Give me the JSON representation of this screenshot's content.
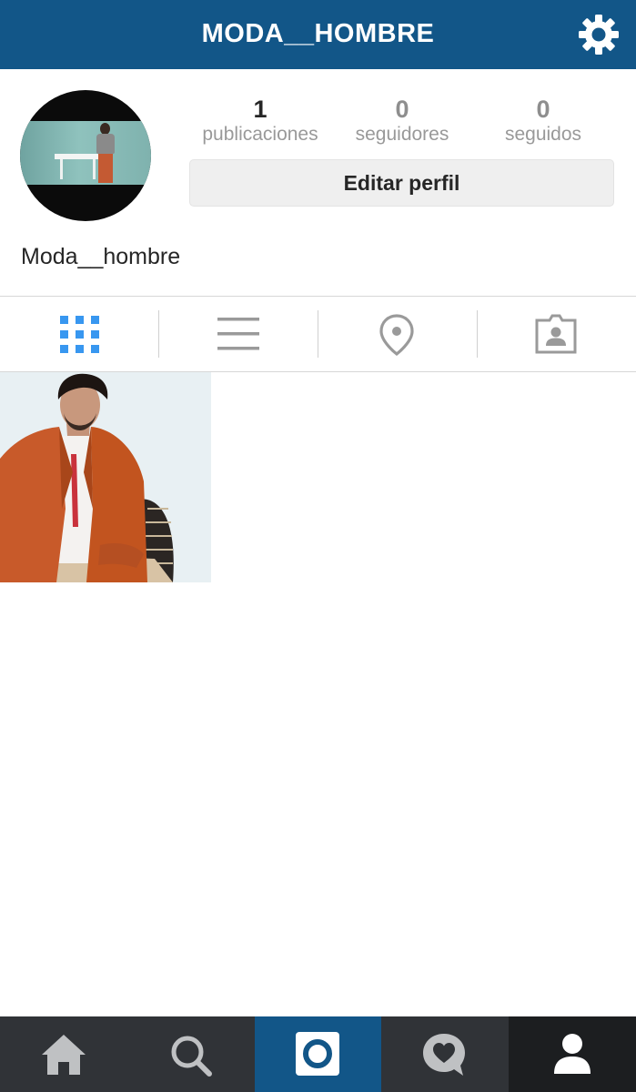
{
  "header": {
    "title": "MODA__HOMBRE",
    "settings_icon": "gear-icon"
  },
  "profile": {
    "avatar_icon": "profile-photo",
    "stats": [
      {
        "value": "1",
        "label": "publicaciones"
      },
      {
        "value": "0",
        "label": "seguidores"
      },
      {
        "value": "0",
        "label": "seguidos"
      }
    ],
    "edit_button_label": "Editar perfil",
    "username": "Moda__hombre"
  },
  "view_tabs": [
    {
      "name": "grid",
      "icon": "grid-icon",
      "active": true
    },
    {
      "name": "list",
      "icon": "list-icon",
      "active": false
    },
    {
      "name": "map",
      "icon": "location-pin-icon",
      "active": false
    },
    {
      "name": "tagged",
      "icon": "tagged-photos-icon",
      "active": false
    }
  ],
  "posts": [
    {
      "kind": "photo",
      "subject": "man in orange blazer"
    }
  ],
  "bottom_nav": [
    {
      "name": "home",
      "icon": "home-icon",
      "active": false
    },
    {
      "name": "search",
      "icon": "search-icon",
      "active": false
    },
    {
      "name": "camera",
      "icon": "camera-icon",
      "active": false
    },
    {
      "name": "activity",
      "icon": "heart-bubble-icon",
      "active": false
    },
    {
      "name": "profile",
      "icon": "profile-icon",
      "active": true
    }
  ],
  "colors": {
    "brand": "#125688",
    "accent_blue": "#3897f0",
    "nav_bg": "#303337",
    "nav_active_bg": "#1c1e20",
    "muted_text": "#999999"
  }
}
